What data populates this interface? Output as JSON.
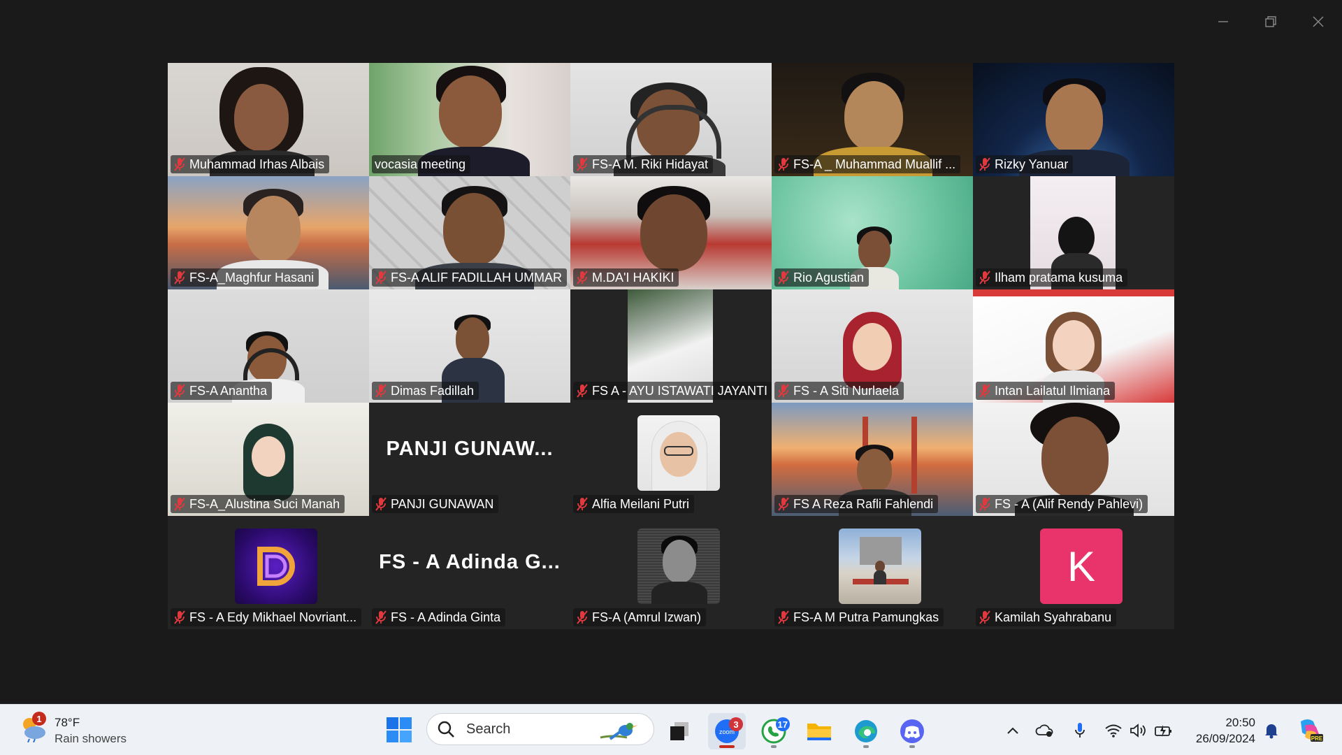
{
  "participants": [
    {
      "name": "Muhammad Irhas Albais",
      "muted": true
    },
    {
      "name": "vocasia meeting",
      "muted": false,
      "active_speaker": true
    },
    {
      "name": "FS-A M. Riki Hidayat",
      "muted": true
    },
    {
      "name": "FS-A _ Muhammad Muallif ...",
      "muted": true
    },
    {
      "name": "Rizky Yanuar",
      "muted": true
    },
    {
      "name": "FS-A_Maghfur Hasani",
      "muted": true
    },
    {
      "name": "FS-A ALIF FADILLAH UMMAR",
      "muted": true
    },
    {
      "name": "M.DA'I HAKIKI",
      "muted": true
    },
    {
      "name": "Rio Agustian",
      "muted": true
    },
    {
      "name": "Ilham pratama kusuma",
      "muted": true
    },
    {
      "name": "FS-A Anantha",
      "muted": true
    },
    {
      "name": "Dimas Fadillah",
      "muted": true
    },
    {
      "name": "FS A - AYU ISTAWATI JAYANTI",
      "muted": true
    },
    {
      "name": "FS - A Siti Nurlaela",
      "muted": true
    },
    {
      "name": "Intan Lailatul Ilmiana",
      "muted": true
    },
    {
      "name": "FS-A_Alustina Suci Manah",
      "muted": true
    },
    {
      "name": "PANJI GUNAWAN",
      "muted": true,
      "display_text": "PANJI  GUNAW..."
    },
    {
      "name": "Alfia Meilani Putri",
      "muted": true
    },
    {
      "name": "FS A Reza Rafli Fahlendi",
      "muted": true
    },
    {
      "name": "FS - A (Alif Rendy Pahlevi)",
      "muted": true
    },
    {
      "name": "FS - A Edy Mikhael Novriant...",
      "muted": true
    },
    {
      "name": "FS - A Adinda Ginta",
      "muted": true,
      "display_text": "FS  -  A  Adinda  G..."
    },
    {
      "name": "FS-A (Amrul Izwan)",
      "muted": true
    },
    {
      "name": "FS-A M Putra Pamungkas",
      "muted": true
    },
    {
      "name": "Kamilah Syahrabanu",
      "muted": true,
      "avatar_letter": "K"
    }
  ],
  "window_controls": {
    "minimize": "minimize-icon",
    "maximize": "restore-icon",
    "close": "close-icon"
  },
  "taskbar": {
    "weather": {
      "temperature": "78°F",
      "condition": "Rain showers",
      "badge": "1"
    },
    "search": {
      "placeholder": "Search"
    },
    "apps": [
      {
        "name": "task-view",
        "badge": ""
      },
      {
        "name": "zoom",
        "badge": "3"
      },
      {
        "name": "whatsapp",
        "badge": "17"
      },
      {
        "name": "file-explorer",
        "badge": ""
      },
      {
        "name": "edge",
        "badge": ""
      },
      {
        "name": "discord",
        "badge": ""
      }
    ],
    "clock": {
      "time": "20:50",
      "date": "26/09/2024"
    }
  },
  "colors": {
    "background": "#1a1a1a",
    "active_speaker_border": "#2fd57a",
    "mute_icon": "#e0393e",
    "taskbar": "#eef1f6",
    "kamilah_avatar": "#e8336b"
  }
}
